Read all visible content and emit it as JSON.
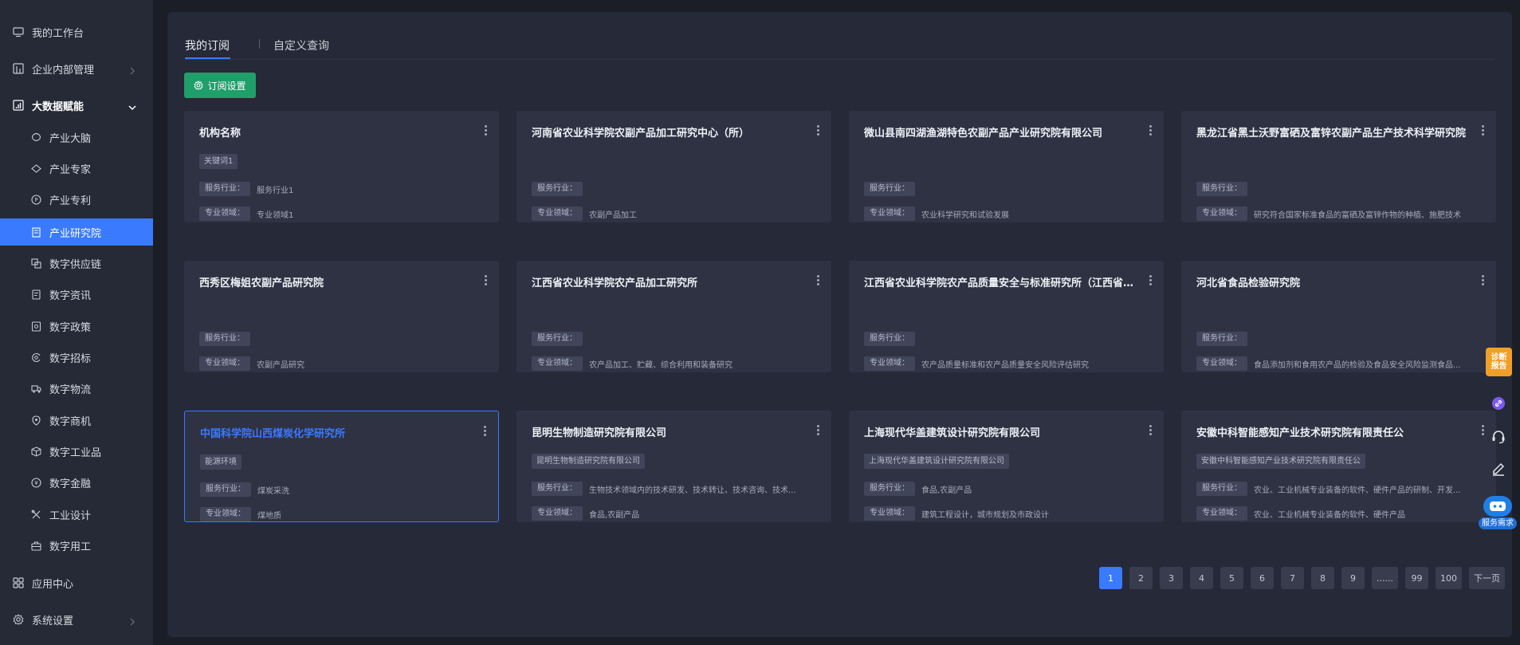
{
  "sidebar": {
    "items": [
      {
        "label": "我的工作台",
        "icon": "monitor-icon"
      },
      {
        "label": "企业内部管理",
        "icon": "dashboard-icon"
      },
      {
        "label": "大数据赋能",
        "icon": "chart-icon"
      },
      {
        "label": "产业大脑",
        "icon": "brain-icon"
      },
      {
        "label": "产业专家",
        "icon": "expert-icon"
      },
      {
        "label": "产业专利",
        "icon": "patent-icon"
      },
      {
        "label": "产业研究院",
        "icon": "institute-icon"
      },
      {
        "label": "数字供应链",
        "icon": "supply-chain-icon"
      },
      {
        "label": "数字资讯",
        "icon": "news-icon"
      },
      {
        "label": "数字政策",
        "icon": "policy-icon"
      },
      {
        "label": "数字招标",
        "icon": "bidding-icon"
      },
      {
        "label": "数字物流",
        "icon": "truck-icon"
      },
      {
        "label": "数字商机",
        "icon": "opportunity-icon"
      },
      {
        "label": "数字工业品",
        "icon": "cube-icon"
      },
      {
        "label": "数字金融",
        "icon": "finance-icon"
      },
      {
        "label": "工业设计",
        "icon": "design-icon"
      },
      {
        "label": "数字用工",
        "icon": "briefcase-icon"
      },
      {
        "label": "应用中心",
        "icon": "apps-icon"
      },
      {
        "label": "系统设置",
        "icon": "gear-icon"
      }
    ],
    "active_item": "产业研究院"
  },
  "tabs": [
    {
      "label": "我的订阅",
      "active": true
    },
    {
      "label": "自定义查询",
      "active": false
    }
  ],
  "subscribe_button": {
    "label": "订阅设置",
    "icon": "gear-icon"
  },
  "cards": [
    {
      "title": "机构名称",
      "tag": "关键词1",
      "industry_label": "服务行业：",
      "industry": "服务行业1",
      "field_label": "专业领域：",
      "field": "专业领域1"
    },
    {
      "title": "河南省农业科学院农副产品加工研究中心（所）",
      "tag": "",
      "industry_label": "服务行业：",
      "industry": "",
      "field_label": "专业领域：",
      "field": "农副产品加工"
    },
    {
      "title": "微山县南四湖渔湖特色农副产品产业研究院有限公司",
      "tag": "",
      "industry_label": "服务行业：",
      "industry": "",
      "field_label": "专业领域：",
      "field": "农业科学研究和试验发展"
    },
    {
      "title": "黑龙江省黑土沃野富硒及富锌农副产品生产技术科学研究院",
      "tag": "",
      "industry_label": "服务行业：",
      "industry": "",
      "field_label": "专业领域：",
      "field": "研究符合国家标准食品的富硒及富锌作物的种植、施肥技术"
    },
    {
      "title": "西秀区梅姐农副产品研究院",
      "tag": "",
      "industry_label": "服务行业：",
      "industry": "",
      "field_label": "专业领域：",
      "field": "农副产品研究"
    },
    {
      "title": "江西省农业科学院农产品加工研究所",
      "tag": "",
      "industry_label": "服务行业：",
      "industry": "",
      "field_label": "专业领域：",
      "field": "农产品加工、贮藏、综合利用和装备研究"
    },
    {
      "title": "江西省农业科学院农产品质量安全与标准研究所（江西省绿...",
      "tag": "",
      "industry_label": "服务行业：",
      "industry": "",
      "field_label": "专业领域：",
      "field": "农产品质量标准和农产品质量安全风险评估研究"
    },
    {
      "title": "河北省食品检验研究院",
      "tag": "",
      "industry_label": "服务行业：",
      "industry": "",
      "field_label": "专业领域：",
      "field": "食品添加剂和食用农产品的检验及食品安全风险监测食品..."
    },
    {
      "title": "中国科学院山西煤炭化学研究所",
      "tag": "能源环境",
      "industry_label": "服务行业：",
      "industry": "煤炭采洗",
      "field_label": "专业领域：",
      "field": "煤地质",
      "selected": true
    },
    {
      "title": "昆明生物制造研究院有限公司",
      "tag": "昆明生物制造研究院有限公司",
      "industry_label": "服务行业：",
      "industry": "生物技术领域内的技术研发、技术转让、技术咨询、技术...",
      "field_label": "专业领域：",
      "field": "食品,农副产品"
    },
    {
      "title": "上海现代华盖建筑设计研究院有限公司",
      "tag": "上海现代华盖建筑设计研究院有限公司",
      "industry_label": "服务行业：",
      "industry": "食品,农副产品",
      "field_label": "专业领域：",
      "field": "建筑工程设计，城市规划及市政设计"
    },
    {
      "title": "安徽中科智能感知产业技术研究院有限责任公",
      "tag": "安徽中科智能感知产业技术研究院有限责任公",
      "industry_label": "服务行业：",
      "industry": "农业、工业机械专业装备的软件、硬件产品的研制、开发...",
      "field_label": "专业领域：",
      "field": "农业、工业机械专业装备的软件、硬件产品"
    }
  ],
  "pagination": {
    "pages": [
      "1",
      "2",
      "3",
      "4",
      "5",
      "6",
      "7",
      "8",
      "9",
      "......",
      "99",
      "100",
      "下一页"
    ],
    "current": "1"
  },
  "floating": {
    "report_line1": "诊断",
    "report_line2": "报告",
    "service_label": "服务需求"
  },
  "colors": {
    "accent": "#3a7afe",
    "subscribe_button": "#1f9f6a",
    "report_badge": "#f0a028"
  }
}
